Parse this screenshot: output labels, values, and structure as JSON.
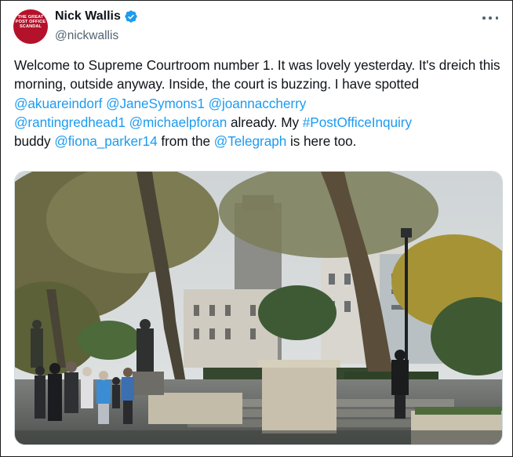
{
  "author": {
    "display_name": "Nick Wallis",
    "handle": "@nickwallis",
    "verified": true,
    "avatar_text": [
      "THE GREAT",
      "POST OFFICE",
      "SCANDAL"
    ]
  },
  "tweet": {
    "t1": "Welcome to Supreme Courtroom number 1. It was lovely yesterday. It's dreich this morning, outside anyway. Inside, the court is buzzing. I have spotted ",
    "m1": "@akuareindorf",
    "s1": " ",
    "m2": "@JaneSymons1",
    "s2": " ",
    "m3": "@joannaccherry",
    "s3": " ",
    "m4": "@rantingredhead1",
    "s4": " ",
    "m5": "@michaelpforan",
    "t2": " already. My ",
    "hashtag": "#PostOfficeInquiry",
    "t3": " buddy ",
    "m6": "@fiona_parker14",
    "t4": " from the ",
    "m7": "@Telegraph",
    "t5": " is here too."
  },
  "icons": {
    "verified": "verified-badge-icon",
    "more": "more-options-icon"
  },
  "colors": {
    "link": "#1d9bf0",
    "text": "#0f1419",
    "secondary": "#536471",
    "verified": "#1d9bf0",
    "avatar_bg": "#b3122a"
  }
}
